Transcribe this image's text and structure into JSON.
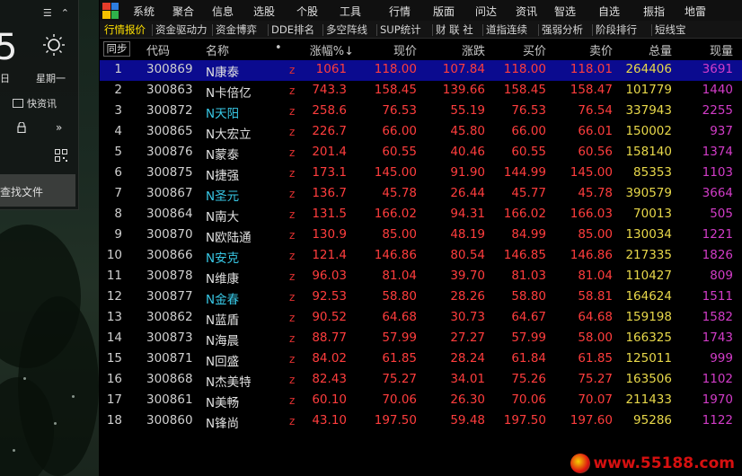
{
  "widget": {
    "hour_digit": "5",
    "day_text": "日",
    "weekday": "星期一",
    "news_label": "快资讯",
    "search_label": "查找文件"
  },
  "menubar": {
    "items": [
      "系统",
      "聚合",
      "信息",
      "选股",
      "个股",
      "工具",
      "行情",
      "版面",
      "问达",
      "资讯",
      "智选",
      "自选",
      "振指",
      "地雷"
    ]
  },
  "tabs": {
    "items": [
      "行情报价",
      "资金驱动力",
      "资金博弈",
      "DDE排名",
      "多空阵线",
      "SUP统计",
      "财 联 社",
      "道指连续",
      "强弱分析",
      "阶段排行",
      "短线宝"
    ],
    "active_index": 0
  },
  "table": {
    "corner_button": "同步",
    "headers": [
      "代码",
      "名称",
      "•",
      "涨幅%↓",
      "现价",
      "涨跌",
      "买价",
      "卖价",
      "总量",
      "现量"
    ],
    "rows": [
      {
        "idx": "1",
        "code": "300869",
        "name": "N康泰",
        "flag": "z",
        "pct": "1061",
        "price": "118.00",
        "chg": "107.84",
        "bid": "118.00",
        "ask": "118.01",
        "vol": "264406",
        "cur": "3691",
        "name_color": "white",
        "selected": true
      },
      {
        "idx": "2",
        "code": "300863",
        "name": "N卡倍亿",
        "flag": "z",
        "pct": "743.3",
        "price": "158.45",
        "chg": "139.66",
        "bid": "158.45",
        "ask": "158.47",
        "vol": "101779",
        "cur": "1440",
        "name_color": "white"
      },
      {
        "idx": "3",
        "code": "300872",
        "name": "N天阳",
        "flag": "z",
        "pct": "258.6",
        "price": "76.53",
        "chg": "55.19",
        "bid": "76.53",
        "ask": "76.54",
        "vol": "337943",
        "cur": "2255",
        "name_color": "cyan"
      },
      {
        "idx": "4",
        "code": "300865",
        "name": "N大宏立",
        "flag": "z",
        "pct": "226.7",
        "price": "66.00",
        "chg": "45.80",
        "bid": "66.00",
        "ask": "66.01",
        "vol": "150002",
        "cur": "937",
        "name_color": "white"
      },
      {
        "idx": "5",
        "code": "300876",
        "name": "N蒙泰",
        "flag": "z",
        "pct": "201.4",
        "price": "60.55",
        "chg": "40.46",
        "bid": "60.55",
        "ask": "60.56",
        "vol": "158140",
        "cur": "1374",
        "name_color": "white"
      },
      {
        "idx": "6",
        "code": "300875",
        "name": "N捷强",
        "flag": "z",
        "pct": "173.1",
        "price": "145.00",
        "chg": "91.90",
        "bid": "144.99",
        "ask": "145.00",
        "vol": "85353",
        "cur": "1103",
        "name_color": "white"
      },
      {
        "idx": "7",
        "code": "300867",
        "name": "N圣元",
        "flag": "z",
        "pct": "136.7",
        "price": "45.78",
        "chg": "26.44",
        "bid": "45.77",
        "ask": "45.78",
        "vol": "390579",
        "cur": "3664",
        "name_color": "cyan"
      },
      {
        "idx": "8",
        "code": "300864",
        "name": "N南大",
        "flag": "z",
        "pct": "131.5",
        "price": "166.02",
        "chg": "94.31",
        "bid": "166.02",
        "ask": "166.03",
        "vol": "70013",
        "cur": "505",
        "name_color": "white"
      },
      {
        "idx": "9",
        "code": "300870",
        "name": "N欧陆通",
        "flag": "z",
        "pct": "130.9",
        "price": "85.00",
        "chg": "48.19",
        "bid": "84.99",
        "ask": "85.00",
        "vol": "130034",
        "cur": "1221",
        "name_color": "white"
      },
      {
        "idx": "10",
        "code": "300866",
        "name": "N安克",
        "flag": "z",
        "pct": "121.4",
        "price": "146.86",
        "chg": "80.54",
        "bid": "146.85",
        "ask": "146.86",
        "vol": "217335",
        "cur": "1826",
        "name_color": "cyan"
      },
      {
        "idx": "11",
        "code": "300878",
        "name": "N维康",
        "flag": "z",
        "pct": "96.03",
        "price": "81.04",
        "chg": "39.70",
        "bid": "81.03",
        "ask": "81.04",
        "vol": "110427",
        "cur": "809",
        "name_color": "white"
      },
      {
        "idx": "12",
        "code": "300877",
        "name": "N金春",
        "flag": "z",
        "pct": "92.53",
        "price": "58.80",
        "chg": "28.26",
        "bid": "58.80",
        "ask": "58.81",
        "vol": "164624",
        "cur": "1511",
        "name_color": "cyan"
      },
      {
        "idx": "13",
        "code": "300862",
        "name": "N蓝盾",
        "flag": "z",
        "pct": "90.52",
        "price": "64.68",
        "chg": "30.73",
        "bid": "64.67",
        "ask": "64.68",
        "vol": "159198",
        "cur": "1582",
        "name_color": "white"
      },
      {
        "idx": "14",
        "code": "300873",
        "name": "N海晨",
        "flag": "z",
        "pct": "88.77",
        "price": "57.99",
        "chg": "27.27",
        "bid": "57.99",
        "ask": "58.00",
        "vol": "166325",
        "cur": "1743",
        "name_color": "white"
      },
      {
        "idx": "15",
        "code": "300871",
        "name": "N回盛",
        "flag": "z",
        "pct": "84.02",
        "price": "61.85",
        "chg": "28.24",
        "bid": "61.84",
        "ask": "61.85",
        "vol": "125011",
        "cur": "999",
        "name_color": "white"
      },
      {
        "idx": "16",
        "code": "300868",
        "name": "N杰美特",
        "flag": "z",
        "pct": "82.43",
        "price": "75.27",
        "chg": "34.01",
        "bid": "75.26",
        "ask": "75.27",
        "vol": "163506",
        "cur": "1102",
        "name_color": "white"
      },
      {
        "idx": "17",
        "code": "300861",
        "name": "N美畅",
        "flag": "z",
        "pct": "60.10",
        "price": "70.06",
        "chg": "26.30",
        "bid": "70.06",
        "ask": "70.07",
        "vol": "211433",
        "cur": "1970",
        "name_color": "white"
      },
      {
        "idx": "18",
        "code": "300860",
        "name": "N锋尚",
        "flag": "z",
        "pct": "43.10",
        "price": "197.50",
        "chg": "59.48",
        "bid": "197.50",
        "ask": "197.60",
        "vol": "95286",
        "cur": "1122",
        "name_color": "white"
      }
    ]
  },
  "watermark": {
    "text": "www.55188.com"
  },
  "colors": {
    "selected_row": "#0b0b8f",
    "up_red": "#ff3d3d",
    "volume_yellow": "#e8d84a",
    "current_volume_purple": "#d23cc8",
    "name_cyan": "#38c8e6",
    "active_tab": "#ffe000"
  }
}
